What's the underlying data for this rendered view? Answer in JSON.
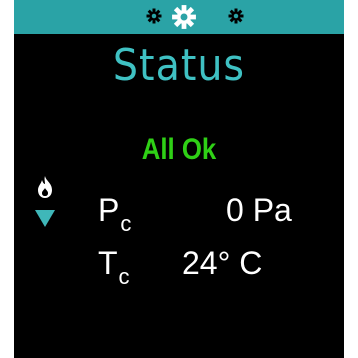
{
  "header": {
    "icons": [
      "gear-icon",
      "gear-icon",
      "gear-icon"
    ]
  },
  "screen": {
    "title": "Status",
    "status_text": "All Ok"
  },
  "side_icons": [
    "flame-icon",
    "arrow-down-icon"
  ],
  "readings": [
    {
      "symbol": "P",
      "subscript": "c",
      "value": "0 Pa"
    },
    {
      "symbol": "T",
      "subscript": "c",
      "value": "24° C"
    }
  ],
  "colors": {
    "header_bg": "#2aa3a6",
    "title": "#3fc1c3",
    "status_ok": "#2fd016",
    "screen_bg": "#000000",
    "text": "#ffffff",
    "arrow": "#3fb7b9"
  }
}
